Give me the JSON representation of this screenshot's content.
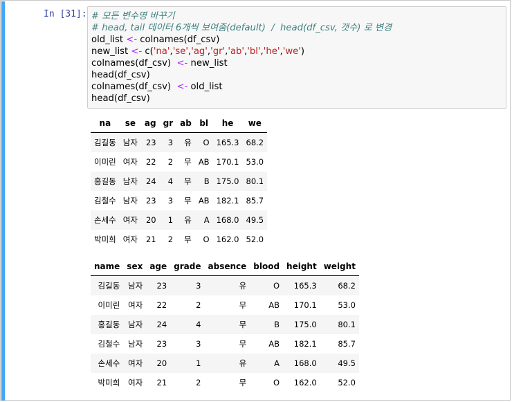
{
  "cell": {
    "prompt": "In [31]:",
    "code": [
      {
        "parts": [
          {
            "t": "# 모든 변수명 바꾸기",
            "c": "cm"
          }
        ]
      },
      {
        "parts": [
          {
            "t": "# head, tail 데이터 6개씩 보여줌(default)  /  head(df_csv, 갯수) 로 변경",
            "c": "cm"
          }
        ]
      },
      {
        "parts": [
          {
            "t": "old_list "
          },
          {
            "t": "<-",
            "c": "op"
          },
          {
            "t": " colnames(df_csv)"
          }
        ]
      },
      {
        "parts": [
          {
            "t": "new_list "
          },
          {
            "t": "<-",
            "c": "op"
          },
          {
            "t": " c("
          },
          {
            "t": "'na'",
            "c": "str"
          },
          {
            "t": ","
          },
          {
            "t": "'se'",
            "c": "str"
          },
          {
            "t": ","
          },
          {
            "t": "'ag'",
            "c": "str"
          },
          {
            "t": ","
          },
          {
            "t": "'gr'",
            "c": "str"
          },
          {
            "t": ","
          },
          {
            "t": "'ab'",
            "c": "str"
          },
          {
            "t": ","
          },
          {
            "t": "'bl'",
            "c": "str"
          },
          {
            "t": ","
          },
          {
            "t": "'he'",
            "c": "str"
          },
          {
            "t": ","
          },
          {
            "t": "'we'",
            "c": "str"
          },
          {
            "t": ")"
          }
        ]
      },
      {
        "parts": [
          {
            "t": "colnames(df_csv)  "
          },
          {
            "t": "<-",
            "c": "op"
          },
          {
            "t": " new_list"
          }
        ]
      },
      {
        "parts": [
          {
            "t": "head(df_csv)"
          }
        ]
      },
      {
        "parts": [
          {
            "t": "colnames(df_csv)  "
          },
          {
            "t": "<-",
            "c": "op"
          },
          {
            "t": " old_list"
          }
        ]
      },
      {
        "parts": [
          {
            "t": "head(df_csv)"
          }
        ]
      }
    ]
  },
  "table1": {
    "headers": [
      "na",
      "se",
      "ag",
      "gr",
      "ab",
      "bl",
      "he",
      "we"
    ],
    "rows": [
      [
        "김길동",
        "남자",
        "23",
        "3",
        "유",
        "O",
        "165.3",
        "68.2"
      ],
      [
        "이미린",
        "여자",
        "22",
        "2",
        "무",
        "AB",
        "170.1",
        "53.0"
      ],
      [
        "홍길동",
        "남자",
        "24",
        "4",
        "무",
        "B",
        "175.0",
        "80.1"
      ],
      [
        "김철수",
        "남자",
        "23",
        "3",
        "무",
        "AB",
        "182.1",
        "85.7"
      ],
      [
        "손세수",
        "여자",
        "20",
        "1",
        "유",
        "A",
        "168.0",
        "49.5"
      ],
      [
        "박미희",
        "여자",
        "21",
        "2",
        "무",
        "O",
        "162.0",
        "52.0"
      ]
    ]
  },
  "table2": {
    "headers": [
      "name",
      "sex",
      "age",
      "grade",
      "absence",
      "blood",
      "height",
      "weight"
    ],
    "rows": [
      [
        "김길동",
        "남자",
        "23",
        "3",
        "유",
        "O",
        "165.3",
        "68.2"
      ],
      [
        "이미린",
        "여자",
        "22",
        "2",
        "무",
        "AB",
        "170.1",
        "53.0"
      ],
      [
        "홍길동",
        "남자",
        "24",
        "4",
        "무",
        "B",
        "175.0",
        "80.1"
      ],
      [
        "김철수",
        "남자",
        "23",
        "3",
        "무",
        "AB",
        "182.1",
        "85.7"
      ],
      [
        "손세수",
        "여자",
        "20",
        "1",
        "유",
        "A",
        "168.0",
        "49.5"
      ],
      [
        "박미희",
        "여자",
        "21",
        "2",
        "무",
        "O",
        "162.0",
        "52.0"
      ]
    ]
  },
  "colors": {
    "cell_bar": "#42a5f5",
    "prompt": "#303f9f",
    "comment": "#408080",
    "operator": "#aa22ff",
    "string": "#ba2121"
  }
}
